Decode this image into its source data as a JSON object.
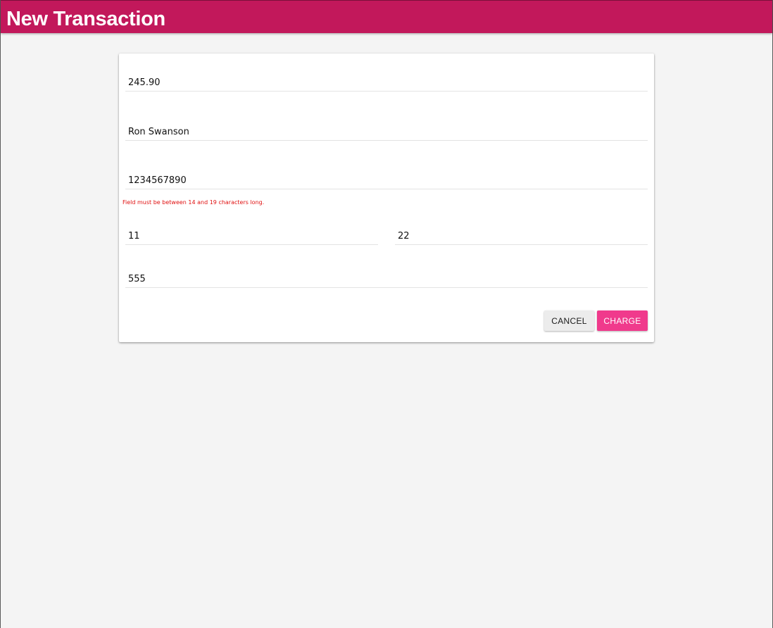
{
  "header": {
    "title": "New Transaction"
  },
  "form": {
    "amount": {
      "value": "245.90"
    },
    "cardholder_name": {
      "value": "Ron Swanson"
    },
    "card_number": {
      "value": "1234567890",
      "error": "Field must be between 14 and 19 characters long."
    },
    "expiry_month": {
      "value": "11"
    },
    "expiry_year": {
      "value": "22"
    },
    "cvv": {
      "value": "555"
    }
  },
  "actions": {
    "cancel_label": "CANCEL",
    "charge_label": "CHARGE"
  },
  "colors": {
    "app_bar": "#c2185b",
    "primary_button": "#f03a8c",
    "error": "#e01010",
    "background": "#f4f4f4"
  }
}
